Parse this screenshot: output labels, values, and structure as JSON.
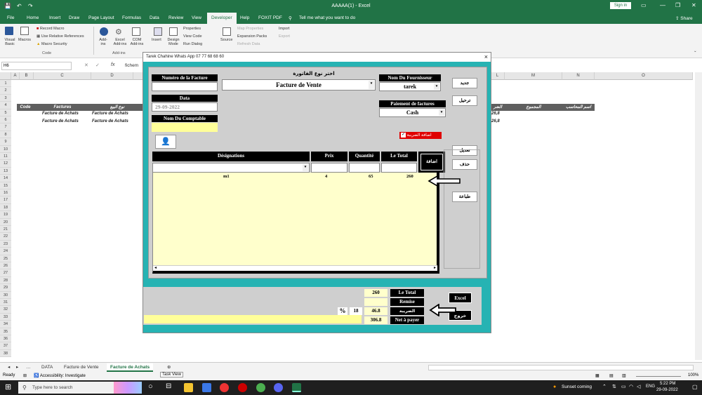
{
  "window": {
    "title": "AAAAA(1) - Excel",
    "signin": "Sign in",
    "share": "Share"
  },
  "menu": {
    "tabs": [
      "File",
      "Home",
      "Insert",
      "Draw",
      "Page Layout",
      "Formulas",
      "Data",
      "Review",
      "View",
      "Developer",
      "Help",
      "FOXIT PDF"
    ],
    "active": "Developer",
    "tell_me": "Tell me what you want to do"
  },
  "ribbon": {
    "visual_basic": "Visual Basic",
    "macros": "Macros",
    "record_macro": "Record Macro",
    "use_relative": "Use Relative References",
    "macro_security": "Macro Security",
    "group_code": "Code",
    "addins": "Add-ins",
    "excel_addins": "Excel Add-ins",
    "com_addins": "COM Add-ins",
    "group_addins": "Add-ins",
    "insert": "Insert",
    "design_mode": "Design Mode",
    "properties": "Properties",
    "view_code": "View Code",
    "run_dialog": "Run Dialog",
    "source": "Source",
    "map_properties": "Map Properties",
    "expansion_packs": "Expansion Packs",
    "refresh_data": "Refresh Data",
    "import": "Import",
    "export": "Export"
  },
  "formula_bar": {
    "name_box": "H6",
    "fx": "fx",
    "content": "fichem"
  },
  "grid": {
    "columns": [
      "A",
      "B",
      "C",
      "D",
      "L",
      "M",
      "N",
      "O"
    ],
    "rows": [
      "1",
      "2",
      "3",
      "4",
      "5",
      "6",
      "7",
      "8",
      "9",
      "10",
      "11",
      "12",
      "13",
      "14",
      "15",
      "16",
      "17",
      "18",
      "19",
      "20",
      "21",
      "22",
      "23",
      "24",
      "25",
      "26",
      "27",
      "28",
      "29",
      "30",
      "31",
      "32",
      "33",
      "34",
      "35",
      "36",
      "37",
      "38"
    ],
    "header_code": "Code",
    "header_factures": "Factures",
    "header_type": "نوع البيع",
    "header_l": "الضر",
    "header_m": "المجموع",
    "header_n": "اسم المحاسب",
    "row5_c": "Facture de Achats",
    "row5_d": "Facture de Achats",
    "row5_l": "26,8",
    "row6_c": "Facture de Achats",
    "row6_d": "Facture de Achats",
    "row6_l": "26,8"
  },
  "sheets": {
    "tabs": [
      "DATA",
      "Facture de Vente",
      "Facture de Achats"
    ],
    "active": "Facture de Achats"
  },
  "status": {
    "ready": "Ready",
    "accessibility": "Accessibility: Investigate",
    "task_view": "Task View",
    "zoom": "100%"
  },
  "taskbar": {
    "search_placeholder": "Type here to search",
    "weather": "Sunset coming",
    "lang": "ENG",
    "time": "5:22 PM",
    "date": "29-09-2022"
  },
  "dialog": {
    "title": "Tarek Chahine Whats App 07 77 68 68 60",
    "close": "×",
    "num_facture_label": "Numéro de la Facture",
    "num_facture_value": "",
    "type_label": "اختر نوع الفاتورة",
    "type_value": "Facture de Vente",
    "fournisseur_label": "Nom Du Fournisseur",
    "fournisseur_value": "tarek",
    "date_label": "Data",
    "date_value": "29-09-2022",
    "paiement_label": "Paiement de factures",
    "paiement_value": "Cash",
    "comptable_label": "Nom Du Comptable",
    "tax_checkbox": "اضافة الضريبة",
    "col_designations": "Désignations",
    "col_prix": "Prix",
    "col_quantite": "Quantité",
    "col_total": "Le Total",
    "btn_add": "اضافة",
    "btn_new": "جديد",
    "btn_save": "ترحيل",
    "btn_edit": "تعديل",
    "btn_delete": "حذف",
    "btn_print": "طباعة",
    "items": [
      {
        "designation": "m1",
        "prix": "4",
        "quantite": "65",
        "total": "260"
      }
    ],
    "total_value": "260",
    "total_label": "Le Total",
    "remise_label": "Remise",
    "remise_value": "",
    "tax_percent_sign": "%",
    "tax_percent": "18",
    "tax_value": "46.8",
    "tax_label": "الضريبة",
    "net_value": "306.8",
    "net_label": "Net à payer",
    "btn_excel": "Excel",
    "btn_exit": "خروج"
  },
  "colors": {
    "excel_green": "#217346",
    "dialog_teal": "#26b3b3",
    "list_yellow": "#ffffcc",
    "tax_red": "#e00000"
  }
}
